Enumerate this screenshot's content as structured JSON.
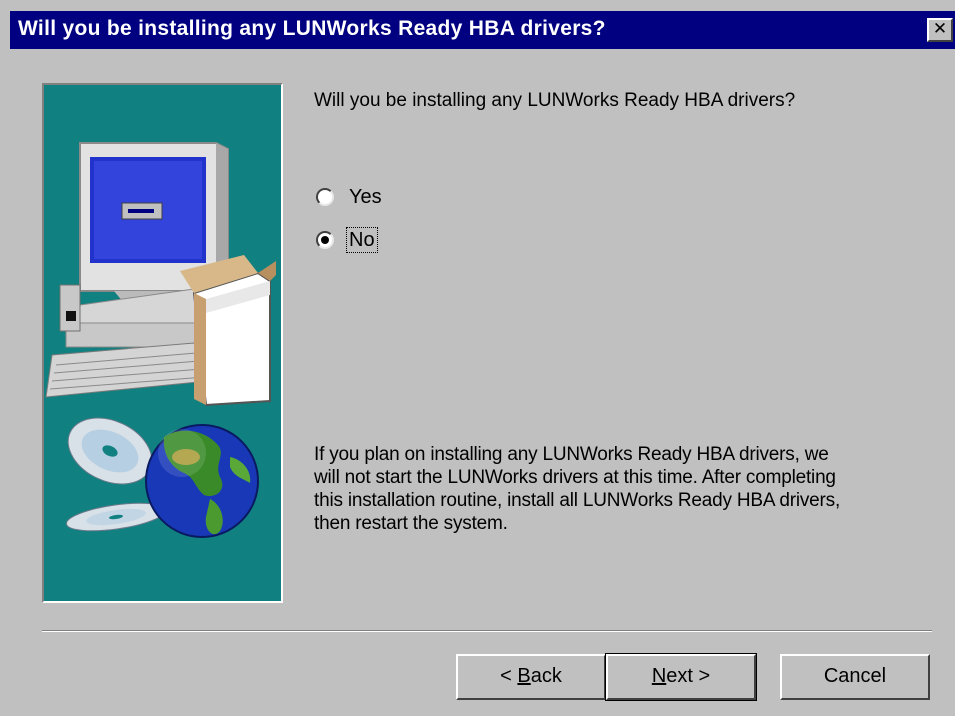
{
  "window": {
    "title": "Will you be installing any LUNWorks Ready HBA drivers?",
    "close_glyph": "✕"
  },
  "content": {
    "question": "Will you be installing any LUNWorks Ready HBA drivers?",
    "options": [
      {
        "label": "Yes",
        "selected": false
      },
      {
        "label": "No",
        "selected": true
      }
    ],
    "info_lines": [
      "If you plan on installing any LUNWorks Ready HBA drivers, we",
      "will not start the LUNWorks drivers at this time.  After completing",
      "this installation routine, install all LUNWorks Ready HBA drivers,",
      "then restart the system."
    ]
  },
  "buttons": {
    "back": {
      "prefix": "< ",
      "mnemonic": "B",
      "rest": "ack"
    },
    "next": {
      "mnemonic": "N",
      "rest": "ext >"
    },
    "cancel": "Cancel"
  },
  "colors": {
    "title_bar": "#000080",
    "dialog_bg": "#c0c0c0",
    "image_bg": "#108080"
  },
  "icons": [
    "computer-illustration",
    "cd-disc-icon",
    "globe-icon",
    "close-icon"
  ]
}
